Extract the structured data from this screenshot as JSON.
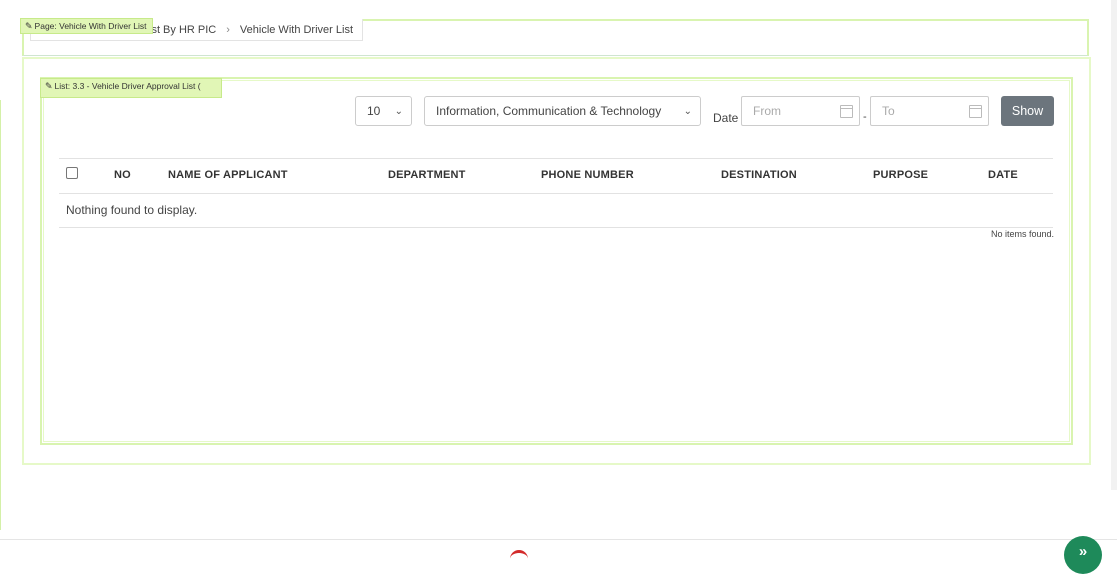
{
  "breadcrumb": {
    "items": [
      "ist By HR PIC",
      "Vehicle With Driver List"
    ],
    "separator": "›"
  },
  "tags": {
    "page": "Page: Vehicle With Driver List",
    "list": "List: 3.3 - Vehicle Driver Approval List ("
  },
  "filters": {
    "page_size": "10",
    "department": "Information, Communication & Technology",
    "date_label": "Date",
    "from_placeholder": "From",
    "to_placeholder": "To",
    "range_sep": "-",
    "show_label": "Show"
  },
  "table": {
    "columns": [
      "NO",
      "NAME OF APPLICANT",
      "DEPARTMENT",
      "PHONE NUMBER",
      "DESTINATION",
      "PURPOSE",
      "DATE"
    ],
    "empty_message": "Nothing found to display.",
    "footer_message": "No items found."
  },
  "icons": {
    "edit": "pencil-icon",
    "calendar": "calendar-icon",
    "dropdown": "chevron-down-icon",
    "fab": "double-chevron-right-icon"
  },
  "colors": {
    "frame_green": "#d9f4b0",
    "button_gray": "#6c757d",
    "fab_green": "#1e8a5a"
  }
}
